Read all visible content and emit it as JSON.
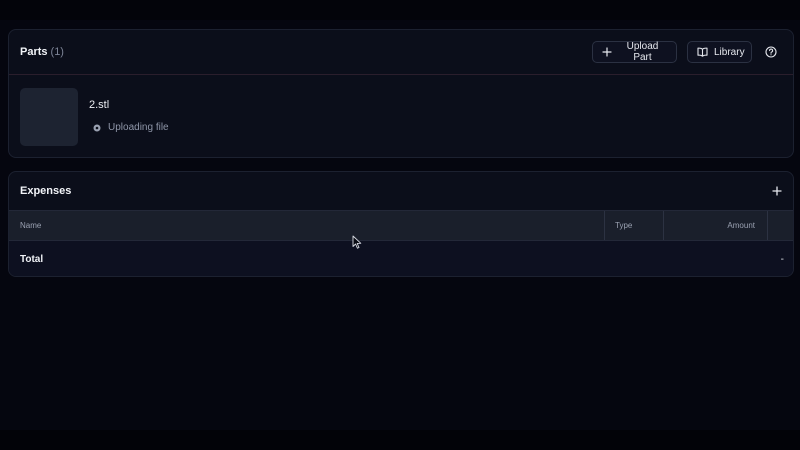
{
  "parts": {
    "title": "Parts",
    "count": "(1)",
    "upload_label": "Upload Part",
    "library_label": "Library",
    "items": [
      {
        "name": "2.stl",
        "status": "Uploading file"
      }
    ]
  },
  "expenses": {
    "title": "Expenses",
    "columns": {
      "name": "Name",
      "type": "Type",
      "amount": "Amount"
    },
    "total_label": "Total",
    "total_value": "-"
  },
  "colors": {
    "background": "#05060f",
    "panel": "#0b0e1a",
    "table_header": "#1a1f2b",
    "text": "#e8eaf0",
    "muted": "#8f96a8"
  },
  "icons": {
    "upload": "plus-icon",
    "library": "book-icon",
    "help": "question-circle-icon",
    "status": "spinner-dot-icon",
    "add_expense": "plus-icon"
  }
}
